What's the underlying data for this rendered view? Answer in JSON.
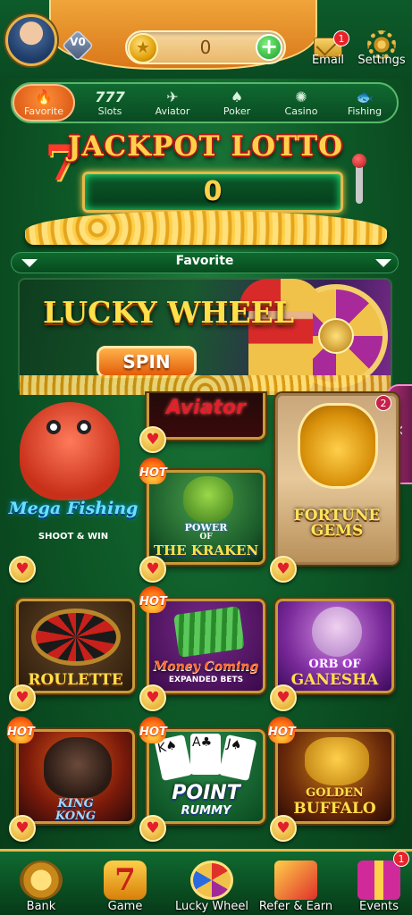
{
  "header": {
    "balance": "0",
    "vip_label": "V0",
    "email_label": "Email",
    "email_badge": "1",
    "settings_label": "Settings"
  },
  "categories": [
    {
      "label": "Favorite",
      "icon": "flame-icon",
      "active": true
    },
    {
      "label": "Slots",
      "icon": "777-icon"
    },
    {
      "label": "Aviator",
      "icon": "rocket-icon"
    },
    {
      "label": "Poker",
      "icon": "cards-icon"
    },
    {
      "label": "Casino",
      "icon": "roulette-icon"
    },
    {
      "label": "Fishing",
      "icon": "fish-icon"
    }
  ],
  "jackpot": {
    "title": "JACKPOT LOTTO",
    "value": "0"
  },
  "favorite_bar": {
    "title": "Favorite"
  },
  "lucky_wheel_banner": {
    "title": "LUCKY WHEEL",
    "button": "SPIN"
  },
  "games": {
    "mega_fishing": {
      "title": "Mega Fishing",
      "subtitle": "SHOOT & WIN"
    },
    "aviator": {
      "title": "Aviator"
    },
    "fortune_gems": {
      "title": "FORTUNE GEMS",
      "badge": "2"
    },
    "kraken": {
      "line1": "POWER",
      "line2": "OF",
      "line3": "THE KRAKEN",
      "hot": "HOT"
    },
    "roulette": {
      "title": "ROULETTE"
    },
    "money_coming": {
      "title": "Money Coming",
      "subtitle": "EXPANDED BETS",
      "hot": "HOT"
    },
    "ganesha": {
      "line1": "ORB OF",
      "line2": "GANESHA"
    },
    "king_kong": {
      "line1": "KING",
      "line2": "KONG",
      "hot": "HOT"
    },
    "point_rummy": {
      "line1": "POINT",
      "line2": "RUMMY",
      "hot": "HOT"
    },
    "golden_buffalo": {
      "line1": "GOLDEN",
      "line2": "BUFFALO",
      "hot": "HOT"
    }
  },
  "nav": [
    {
      "label": "Bank"
    },
    {
      "label": "Game"
    },
    {
      "label": "Lucky Wheel"
    },
    {
      "label": "Refer & Earn"
    },
    {
      "label": "Events",
      "badge": "1"
    }
  ],
  "colors": {
    "accent_orange": "#e35d08",
    "gold": "#e8b84a",
    "green_bg": "#0e5a28"
  }
}
